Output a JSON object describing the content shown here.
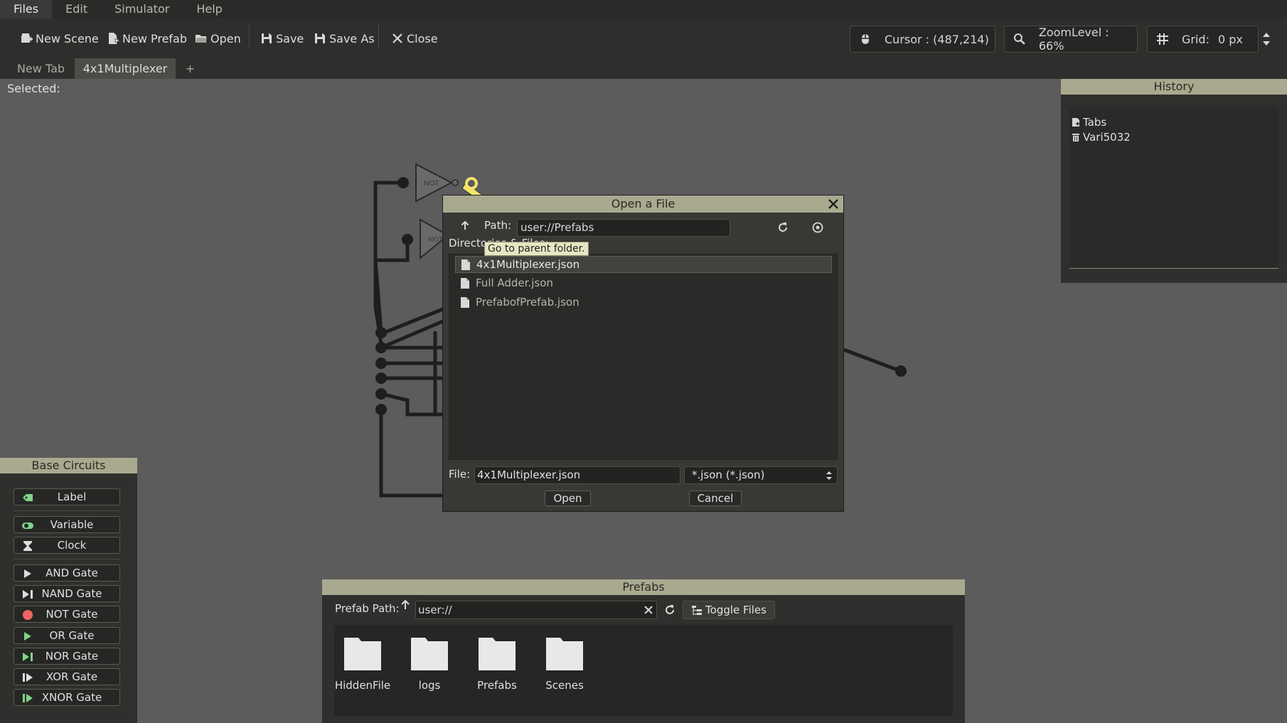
{
  "menu": {
    "items": [
      "Files",
      "Edit",
      "Simulator",
      "Help"
    ]
  },
  "toolbar": {
    "new_scene": "New Scene",
    "new_prefab": "New Prefab",
    "open": "Open",
    "save": "Save",
    "save_as": "Save As",
    "close": "Close",
    "cursor": "Cursor : (487,214)",
    "zoom": "ZoomLevel : 66%",
    "grid_label": "Grid:",
    "grid_value": "0 px"
  },
  "tabs": {
    "items": [
      "New Tab",
      "4x1Multiplexer"
    ],
    "add": "+"
  },
  "selected_label": "Selected:",
  "circuit": {
    "gate_label": "NOT"
  },
  "history": {
    "title": "History",
    "items": [
      {
        "label": "Tabs",
        "icon": "file-icon"
      },
      {
        "label": "Vari5032",
        "icon": "trash-icon"
      }
    ]
  },
  "base_circuits": {
    "title": "Base Circuits",
    "items": [
      {
        "label": "Label",
        "icon": "label-icon",
        "color": "#7fd48a"
      },
      {
        "label": "Variable",
        "icon": "toggle-icon",
        "color": "#7fd48a"
      },
      {
        "label": "Clock",
        "icon": "hourglass-icon",
        "color": "#dedede"
      },
      {
        "label": "AND Gate",
        "icon": "and-gate-icon",
        "color": "#dedede"
      },
      {
        "label": "NAND Gate",
        "icon": "nand-gate-icon",
        "color": "#dedede"
      },
      {
        "label": "NOT Gate",
        "icon": "not-gate-icon",
        "color": "#f06464"
      },
      {
        "label": "OR Gate",
        "icon": "or-gate-icon",
        "color": "#7fd48a"
      },
      {
        "label": "NOR Gate",
        "icon": "nor-gate-icon",
        "color": "#7fd48a"
      },
      {
        "label": "XOR Gate",
        "icon": "xor-gate-icon",
        "color": "#dedede"
      },
      {
        "label": "XNOR Gate",
        "icon": "xnor-gate-icon",
        "color": "#7fd48a"
      }
    ]
  },
  "prefabs": {
    "title": "Prefabs",
    "path_label": "Prefab Path:",
    "path_value": "user://",
    "toggle_files": "Toggle Files",
    "folders": [
      "HiddenFile",
      "logs",
      "Prefabs",
      "Scenes"
    ]
  },
  "dialog": {
    "title": "Open a File",
    "path_label": "Path:",
    "path_value": "user://Prefabs",
    "dirs_label": "Directories & Files:",
    "tooltip": "Go to parent folder.",
    "files": [
      "4x1Multiplexer.json",
      "Full Adder.json",
      "PrefabofPrefab.json"
    ],
    "file_label": "File:",
    "file_value": "4x1Multiplexer.json",
    "filter_value": "*.json (*.json)",
    "open_button": "Open",
    "cancel_button": "Cancel"
  },
  "colors": {
    "panel_header": "#a9a98f",
    "background": "#5c5c5c",
    "accent_green": "#7fd48a",
    "accent_red": "#f06464"
  }
}
